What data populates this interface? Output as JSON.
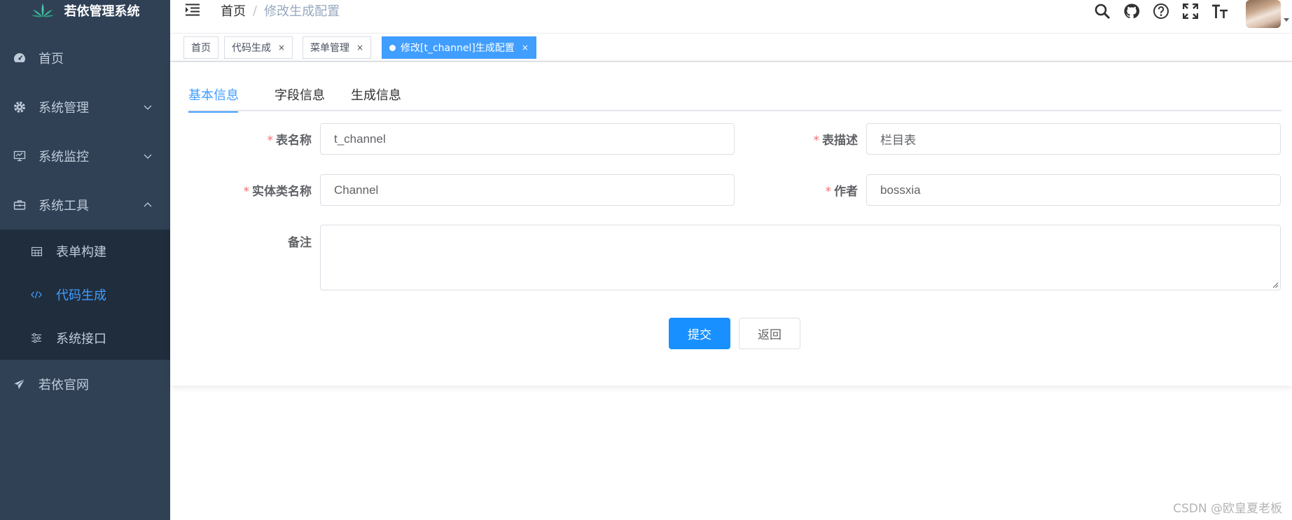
{
  "app": {
    "title": "若依管理系统"
  },
  "sidebar": {
    "items": [
      {
        "label": "首页",
        "icon": "dashboard-icon"
      },
      {
        "label": "系统管理",
        "icon": "gear-icon",
        "expanded": false
      },
      {
        "label": "系统监控",
        "icon": "monitor-icon",
        "expanded": false
      },
      {
        "label": "系统工具",
        "icon": "toolbox-icon",
        "expanded": true
      },
      {
        "label": "若依官网",
        "icon": "paper-plane-icon"
      }
    ],
    "tool_submenu": [
      {
        "label": "表单构建",
        "icon": "table-icon"
      },
      {
        "label": "代码生成",
        "icon": "code-icon",
        "active": true
      },
      {
        "label": "系统接口",
        "icon": "sliders-icon"
      }
    ]
  },
  "navbar": {
    "breadcrumb": {
      "home": "首页",
      "separator": "/",
      "current": "修改生成配置"
    },
    "icons": [
      "search-icon",
      "github-icon",
      "help-icon",
      "fullscreen-icon",
      "font-size-icon"
    ]
  },
  "tags": [
    {
      "label": "首页",
      "closable": false
    },
    {
      "label": "代码生成",
      "closable": true
    },
    {
      "label": "菜单管理",
      "closable": true
    },
    {
      "label": "修改[t_channel]生成配置",
      "closable": true,
      "active": true
    }
  ],
  "tag_close_glyph": "×",
  "tabs": [
    {
      "label": "基本信息",
      "active": true
    },
    {
      "label": "字段信息"
    },
    {
      "label": "生成信息"
    }
  ],
  "form": {
    "required_mark": "*",
    "table_name": {
      "label": "表名称",
      "value": "t_channel"
    },
    "table_comment": {
      "label": "表描述",
      "value": "栏目表"
    },
    "class_name": {
      "label": "实体类名称",
      "value": "Channel"
    },
    "author": {
      "label": "作者",
      "value": "bossxia"
    },
    "remark": {
      "label": "备注",
      "value": ""
    }
  },
  "buttons": {
    "submit": "提交",
    "back": "返回"
  },
  "watermark": "CSDN @欧皇夏老板",
  "colors": {
    "sidebar_bg": "#304156",
    "submenu_bg": "#1f2d3d",
    "accent": "#409eff",
    "primary_button": "#1890ff",
    "required": "#f56c6c"
  }
}
